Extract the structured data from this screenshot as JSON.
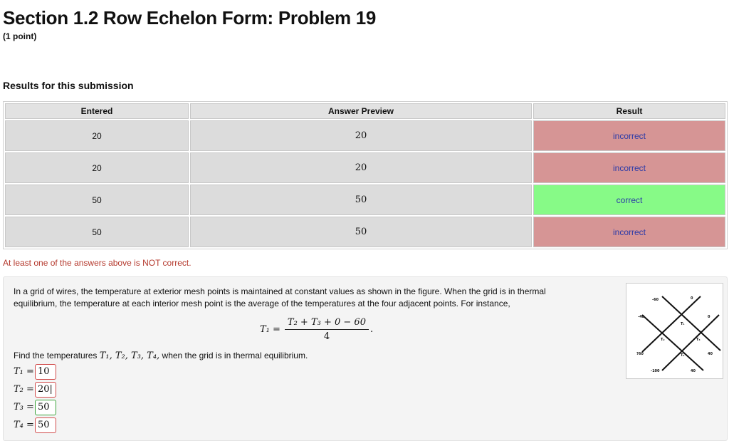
{
  "title": "Section 1.2 Row Echelon Form: Problem 19",
  "points": "(1 point)",
  "results_heading": "Results for this submission",
  "table": {
    "headers": [
      "Entered",
      "Answer Preview",
      "Result"
    ],
    "rows": [
      {
        "entered": "20",
        "preview": "20",
        "result": "incorrect"
      },
      {
        "entered": "20",
        "preview": "20",
        "result": "incorrect"
      },
      {
        "entered": "50",
        "preview": "50",
        "result": "correct"
      },
      {
        "entered": "50",
        "preview": "50",
        "result": "incorrect"
      }
    ]
  },
  "warning": "At least one of the answers above is NOT correct.",
  "problem": {
    "description": "In a grid of wires, the temperature at exterior mesh points is maintained at constant values as shown in the figure. When the grid is in thermal equilibrium, the temperature at each interior mesh point is the average of the temperatures at the four adjacent points. For instance,",
    "formula_lhs": "T₁ =",
    "formula_num": "T₂ + T₃ + 0 − 60",
    "formula_den": "4",
    "formula_end": ".",
    "find_prefix": "Find the temperatures ",
    "find_vars": "T₁, T₂, T₃, T₄,",
    "find_suffix": " when the grid is in thermal equilibrium.",
    "answers": [
      {
        "label": "T₁ =",
        "value": "10"
      },
      {
        "label": "T₂ =",
        "value": "20|"
      },
      {
        "label": "T₃ =",
        "value": "50"
      },
      {
        "label": "T₄ =",
        "value": "50"
      }
    ],
    "figure_labels": {
      "top_left": "-60",
      "top_right": "0",
      "left_upper": "-40",
      "right_upper": "0",
      "left_lower": "?60",
      "right_lower": "40",
      "bottom_left": "-100",
      "bottom_right": "40",
      "t1": "T₁",
      "t2": "T₂",
      "t3": "T₃",
      "t4": "T₄"
    }
  },
  "colors": {
    "incorrect": "#d69595",
    "correct": "#87fa87",
    "warning": "#b53a2e",
    "result_text": "#2b3aa8"
  }
}
